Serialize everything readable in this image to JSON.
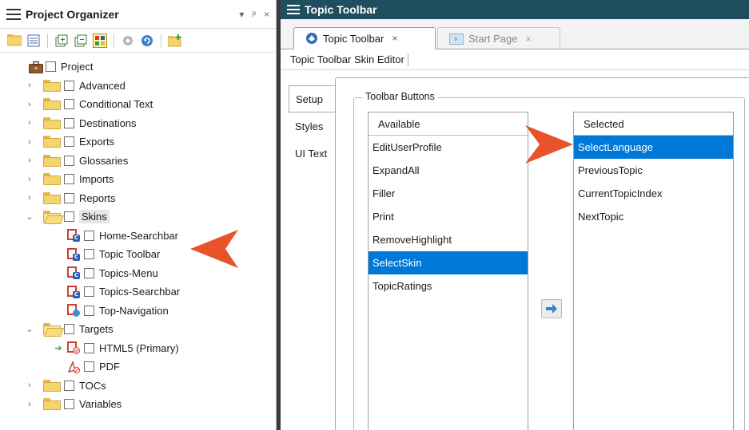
{
  "project_organizer": {
    "title": "Project Organizer",
    "controls": [
      "▾",
      "ᵖ",
      "×"
    ],
    "tree": {
      "root": "Project",
      "folders_before": [
        "Advanced",
        "Conditional Text",
        "Destinations",
        "Exports",
        "Glossaries",
        "Imports",
        "Reports"
      ],
      "skins": {
        "label": "Skins",
        "items": [
          "Home-Searchbar",
          "Topic Toolbar",
          "Topics-Menu",
          "Topics-Searchbar",
          "Top-Navigation"
        ]
      },
      "targets": {
        "label": "Targets",
        "items": [
          "HTML5 (Primary)",
          "PDF"
        ]
      },
      "folders_after": [
        "TOCs",
        "Variables"
      ]
    }
  },
  "topic_toolbar": {
    "window_title": "Topic Toolbar",
    "tabs": [
      {
        "label": "Topic Toolbar",
        "close": "×"
      },
      {
        "label": "Start Page",
        "close": "×"
      }
    ],
    "editor_label": "Topic Toolbar Skin Editor",
    "side_tabs": [
      "Setup",
      "Styles",
      "UI Text"
    ],
    "group_title": "Toolbar Buttons",
    "available": {
      "header": "Available",
      "items": [
        "EditUserProfile",
        "ExpandAll",
        "Filler",
        "Print",
        "RemoveHighlight",
        "SelectSkin",
        "TopicRatings"
      ],
      "selected_item": "SelectSkin"
    },
    "selected": {
      "header": "Selected",
      "items": [
        "SelectLanguage",
        "PreviousTopic",
        "CurrentTopicIndex",
        "NextTopic"
      ],
      "selected_item": "SelectLanguage"
    }
  },
  "colors": {
    "accent": "#0078d7",
    "header_dark": "#1f4e5e",
    "callout_arrow": "#e8532a"
  }
}
